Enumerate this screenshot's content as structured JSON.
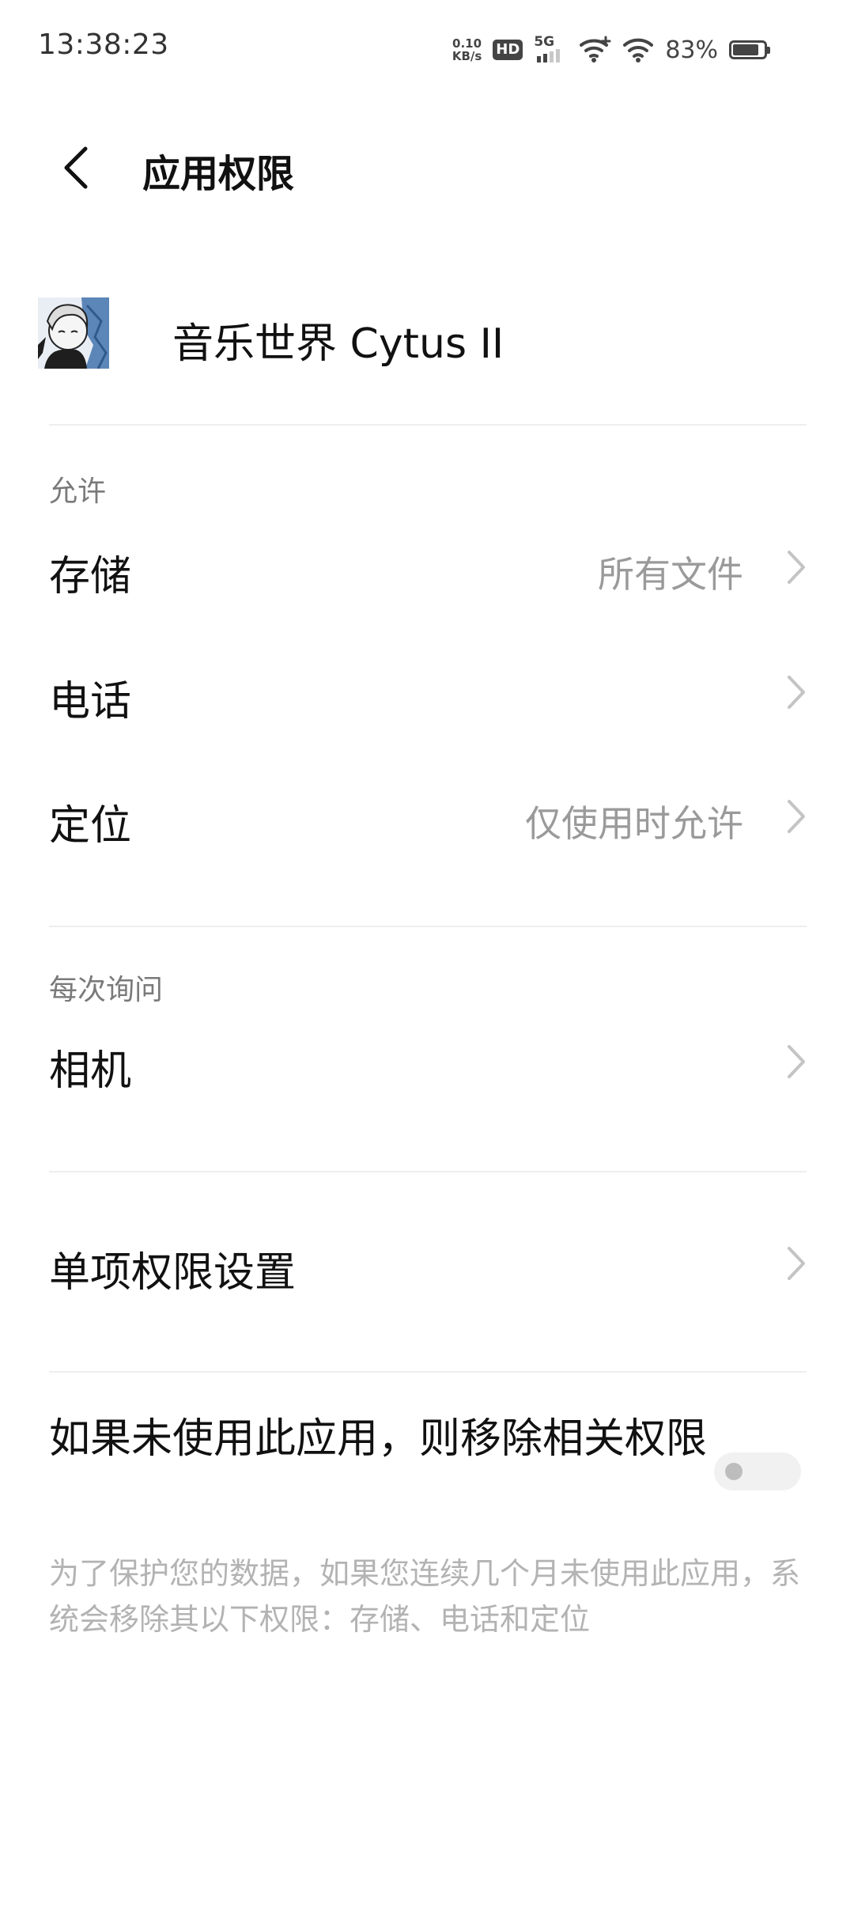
{
  "status_bar": {
    "time": "13:38:23",
    "net_speed_value": "0.10",
    "net_speed_unit": "KB/s",
    "hd": "HD",
    "network": "5G",
    "battery_percent": "83%",
    "battery_level": 0.83
  },
  "header": {
    "back_icon": "chevron-left-icon",
    "title": "应用权限"
  },
  "app": {
    "name": "音乐世界 Cytus II"
  },
  "sections": {
    "allowed": {
      "label": "允许",
      "items": [
        {
          "name": "存储",
          "value": "所有文件"
        },
        {
          "name": "电话",
          "value": ""
        },
        {
          "name": "定位",
          "value": "仅使用时允许"
        }
      ]
    },
    "ask_every_time": {
      "label": "每次询问",
      "items": [
        {
          "name": "相机",
          "value": ""
        }
      ]
    }
  },
  "single_permission": {
    "label": "单项权限设置"
  },
  "auto_revoke": {
    "title": "如果未使用此应用，则移除相关权限",
    "enabled": false,
    "description": "为了保护您的数据，如果您连续几个月未使用此应用，系统会移除其以下权限：存储、电话和定位"
  }
}
